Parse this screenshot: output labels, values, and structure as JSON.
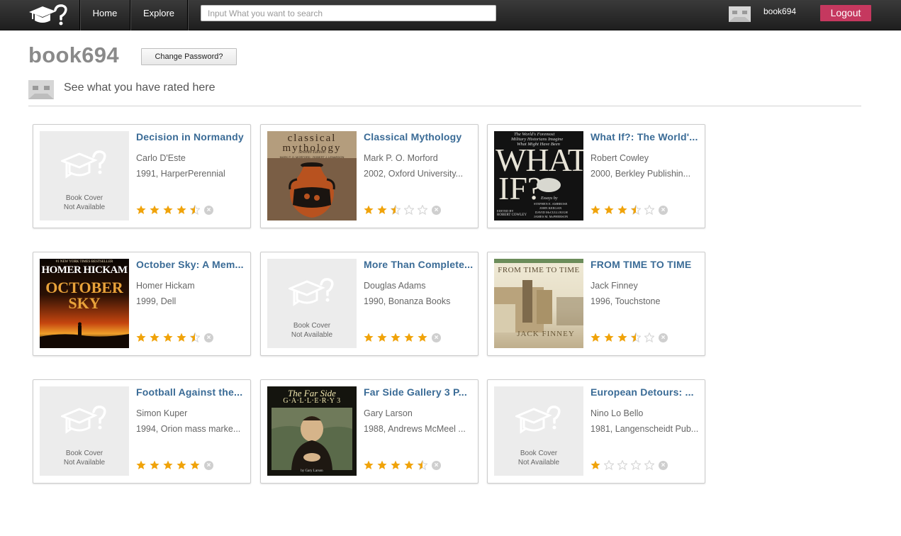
{
  "nav": {
    "home": "Home",
    "explore": "Explore",
    "search_placeholder": "Input What you want to search",
    "user": "book694",
    "logout": "Logout"
  },
  "profile": {
    "username": "book694",
    "change_password": "Change Password?",
    "subtitle": "See what you have rated here"
  },
  "cover_na": {
    "line1": "Book Cover",
    "line2": "Not Available"
  },
  "colors": {
    "accent": "#c5385f",
    "link": "#3a6b96",
    "star": "#f0a30a",
    "star_empty": "#d8d8d8"
  },
  "books": [
    {
      "title": "Decision in Normandy",
      "author": "Carlo D'Este",
      "pub": "1991, HarperPerennial",
      "rating": 4.5,
      "cover": "none"
    },
    {
      "title": "Classical Mythology",
      "author": "Mark P. O. Morford",
      "pub": "2002, Oxford University...",
      "rating": 2.5,
      "cover": "classical",
      "cover_text": [
        "classical",
        "mythology",
        "Seventh Edition",
        "MARK P. O. MORFORD · ROBERT J. LENARDON"
      ]
    },
    {
      "title": "What If?: The World'...",
      "author": "Robert Cowley",
      "pub": "2000, Berkley Publishin...",
      "rating": 3.5,
      "cover": "whatif",
      "cover_text": [
        "The World's Foremost",
        "Military Historians Imagine",
        "What Might Have Been",
        "WHAT",
        "IF?",
        "Essays by",
        "STEPHEN E. AMBROSE",
        "JOHN KEEGAN",
        "DAVID McCULLOUGH",
        "JAMES M. McPHERSON",
        "EDITED BY",
        "ROBERT COWLEY"
      ]
    },
    {
      "title": "October Sky: A Mem...",
      "author": "Homer Hickam",
      "pub": "1999, Dell",
      "rating": 4.5,
      "cover": "october",
      "cover_text": [
        "#1 NEW YORK TIMES BESTSELLER",
        "HOMER HICKAM",
        "OCTOBER",
        "SKY"
      ]
    },
    {
      "title": "More Than Complete...",
      "author": "Douglas Adams",
      "pub": "1990, Bonanza Books",
      "rating": 5,
      "cover": "none"
    },
    {
      "title": "FROM TIME TO TIME",
      "author": "Jack Finney",
      "pub": "1996, Touchstone",
      "rating": 3.5,
      "cover": "fromtime",
      "cover_text": [
        "FROM TIME TO TIME",
        "JACK FINNEY"
      ]
    },
    {
      "title": "Football Against the...",
      "author": "Simon Kuper",
      "pub": "1994, Orion mass marke...",
      "rating": 5,
      "cover": "none"
    },
    {
      "title": "Far Side Gallery 3 P...",
      "author": "Gary Larson",
      "pub": "1988, Andrews McMeel ...",
      "rating": 4.5,
      "cover": "farside",
      "cover_text": [
        "The Far Side",
        "G·A·L·L·E·R·Y 3",
        "by Gary Larson"
      ]
    },
    {
      "title": "European Detours: ...",
      "author": "Nino Lo Bello",
      "pub": "1981, Langenscheidt Pub...",
      "rating": 1,
      "cover": "none"
    }
  ]
}
